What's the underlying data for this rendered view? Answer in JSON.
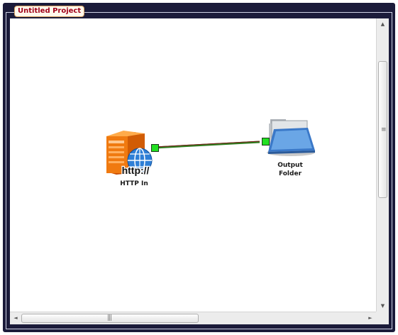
{
  "project": {
    "title": "Untitled Project"
  },
  "nodes": {
    "http_in": {
      "label": "HTTP In",
      "badge": "http://"
    },
    "output_folder": {
      "label_line1": "Output",
      "label_line2": "Folder"
    }
  },
  "scrollbars": {
    "vertical": {
      "up_arrow": "▲",
      "down_arrow": "▼",
      "grip": "≡"
    },
    "horizontal": {
      "left_arrow": "◄",
      "right_arrow": "►",
      "grip": "|||"
    }
  }
}
